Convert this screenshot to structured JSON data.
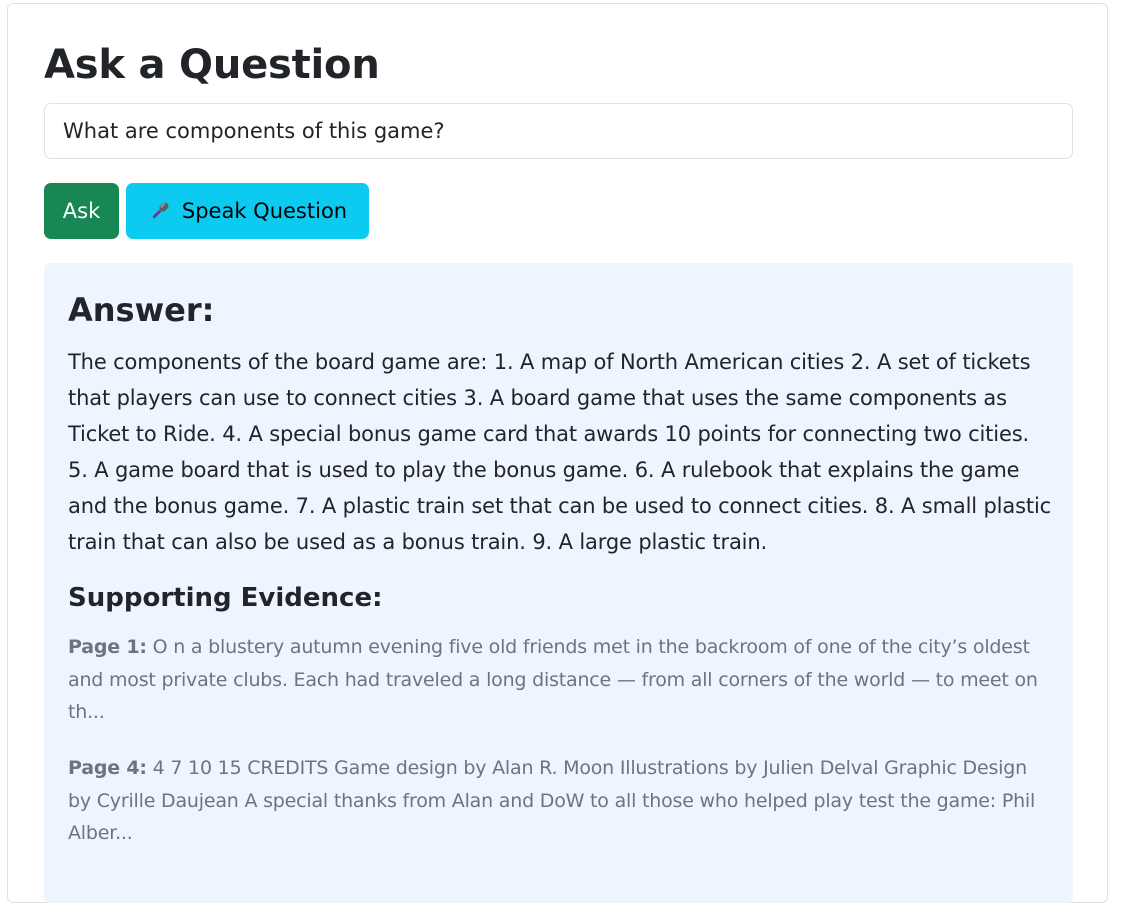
{
  "page": {
    "title": "Ask a Question"
  },
  "question": {
    "value": "What are components of this game?"
  },
  "buttons": {
    "ask_label": "Ask",
    "speak_label": "Speak Question",
    "speak_icon": "microphone-icon"
  },
  "answer": {
    "heading": "Answer:",
    "text": "The components of the board game are: 1. A map of North American cities 2. A set of tickets that players can use to connect cities 3. A board game that uses the same components as Ticket to Ride. 4. A special bonus game card that awards 10 points for connecting two cities. 5. A game board that is used to play the bonus game. 6. A rulebook that explains the game and the bonus game. 7. A plastic train set that can be used to connect cities. 8. A small plastic train that can also be used as a bonus train. 9. A large plastic train."
  },
  "evidence": {
    "heading": "Supporting Evidence:",
    "items": [
      {
        "label": "Page 1:",
        "text": " O n a blustery autumn evening five old friends met in the backroom of one of the city’s oldest and most private clubs. Each had traveled a long distance — from all corners of the world — to meet on th..."
      },
      {
        "label": "Page 4:",
        "text": " 4 7 10 15 CREDITS Game design by Alan R. Moon Illustrations by Julien Delval Graphic Design by Cyrille Daujean A special thanks from Alan and DoW to all those who helped play test the game: Phil Alber..."
      }
    ]
  },
  "colors": {
    "ask_button": "#198754",
    "speak_button": "#0dcaf0",
    "answer_background": "#eef5fe",
    "evidence_text": "#6c757d"
  }
}
